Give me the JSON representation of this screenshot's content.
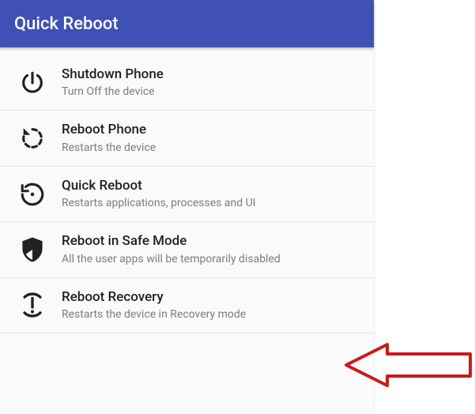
{
  "header": {
    "title": "Quick Reboot"
  },
  "items": [
    {
      "icon": "power-icon",
      "title": "Shutdown Phone",
      "subtitle": "Turn Off the device"
    },
    {
      "icon": "restart-icon",
      "title": "Reboot Phone",
      "subtitle": "Restarts the device"
    },
    {
      "icon": "history-icon",
      "title": "Quick Reboot",
      "subtitle": "Restarts applications, processes and UI"
    },
    {
      "icon": "shield-icon",
      "title": "Reboot in Safe Mode",
      "subtitle": "All the user apps will be temporarily disabled"
    },
    {
      "icon": "recovery-icon",
      "title": "Reboot Recovery",
      "subtitle": "Restarts the device in Recovery mode"
    }
  ],
  "annotation": {
    "arrow_color": "#c91a1a"
  }
}
